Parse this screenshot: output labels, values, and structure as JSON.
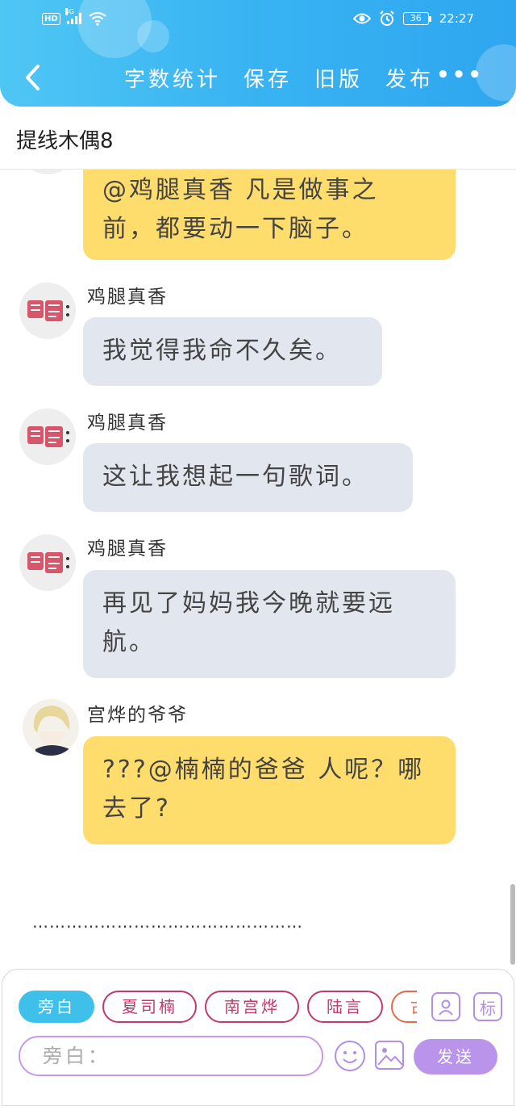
{
  "status_bar": {
    "hd": "HD",
    "network": "4G",
    "battery": "36",
    "time": "22:27"
  },
  "nav": {
    "items": [
      "字数统计",
      "保存",
      "旧版",
      "发布"
    ],
    "more": "•••"
  },
  "title": "提线木偶8",
  "messages": [
    {
      "sender": "",
      "text_lines": [
        "@鸡腿真香 凡是做事之",
        "前，都要动一下脑子。"
      ],
      "color": "#ffdd6d"
    },
    {
      "sender": "鸡腿真香",
      "text_lines": [
        "我觉得我命不久矣。"
      ],
      "color": "#e2e6ee"
    },
    {
      "sender": "鸡腿真香",
      "text_lines": [
        "这让我想起一句歌词。"
      ],
      "color": "#e2e6ee"
    },
    {
      "sender": "鸡腿真香",
      "text_lines": [
        "再见了妈妈我今晚就要远",
        "航。"
      ],
      "color": "#e2e6ee"
    },
    {
      "sender": "宫烨的爷爷",
      "text_lines": [
        "???@楠楠的爸爸 人呢？哪",
        "去了?"
      ],
      "color": "#ffdd6d"
    }
  ],
  "ellipsis": "…………………………………………",
  "bottom": {
    "roles": [
      {
        "label": "旁白",
        "active": true
      },
      {
        "label": "夏司楠",
        "active": false
      },
      {
        "label": "南宫烨",
        "active": false
      },
      {
        "label": "陆言",
        "active": false
      },
      {
        "label": "古",
        "active": false
      }
    ],
    "mark_label": "标",
    "input_placeholder": "旁白：",
    "send_label": "发送"
  }
}
